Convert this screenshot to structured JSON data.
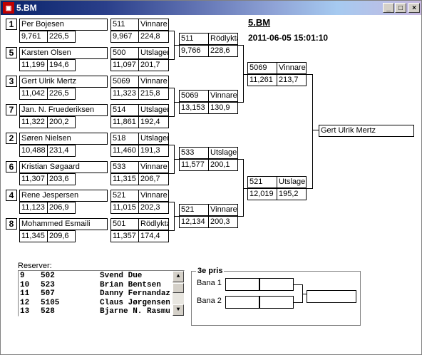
{
  "window": {
    "title": "5.BM",
    "icon": "app-icon",
    "minimize": "_",
    "maximize": "□",
    "close": "×"
  },
  "event": {
    "title": "5.BM",
    "datetime": "2011-06-05 15:01:10"
  },
  "round1": [
    {
      "seed": "1",
      "name": "Per Bojesen",
      "score1": "9,761",
      "score2": "226,5"
    },
    {
      "seed": "5",
      "name": "Karsten Olsen",
      "score1": "11,199",
      "score2": "194,6"
    },
    {
      "seed": "3",
      "name": "Gert Ulrik Mertz",
      "score1": "11,042",
      "score2": "226,5"
    },
    {
      "seed": "7",
      "name": "Jan. N. Fruederiksen",
      "score1": "11,322",
      "score2": "200,2"
    },
    {
      "seed": "2",
      "name": "Søren Nielsen",
      "score1": "10,488",
      "score2": "231,4"
    },
    {
      "seed": "6",
      "name": "Kristian Søgaard",
      "score1": "11,307",
      "score2": "203,6"
    },
    {
      "seed": "4",
      "name": "Rene Jespersen",
      "score1": "11,123",
      "score2": "206,9"
    },
    {
      "seed": "8",
      "name": "Mohammed Esmaili",
      "score1": "11,345",
      "score2": "209,6"
    }
  ],
  "round1_results": [
    {
      "num": "511",
      "status": "Vinnare",
      "score1": "9,967",
      "score2": "224,8"
    },
    {
      "num": "500",
      "status": "Utslagen",
      "score1": "11,097",
      "score2": "201,7"
    },
    {
      "num": "5069",
      "status": "Vinnare",
      "score1": "11,323",
      "score2": "215,8"
    },
    {
      "num": "514",
      "status": "Utslagen",
      "score1": "11,861",
      "score2": "192,4"
    },
    {
      "num": "518",
      "status": "Utslagen",
      "score1": "11,460",
      "score2": "191,3"
    },
    {
      "num": "533",
      "status": "Vinnare",
      "score1": "11,315",
      "score2": "206,7"
    },
    {
      "num": "521",
      "status": "Vinnare",
      "score1": "11,015",
      "score2": "202,3"
    },
    {
      "num": "501",
      "status": "Rödlykta",
      "score1": "11,357",
      "score2": "174,4"
    }
  ],
  "round2": [
    {
      "num": "511",
      "status": "Rödlykta",
      "score1": "9,766",
      "score2": "228,6"
    },
    {
      "num": "5069",
      "status": "Vinnare",
      "score1": "13,153",
      "score2": "130,9"
    },
    {
      "num": "533",
      "status": "Utslagen",
      "score1": "11,577",
      "score2": "200,1"
    },
    {
      "num": "521",
      "status": "Vinnare",
      "score1": "12,134",
      "score2": "200,3"
    }
  ],
  "round3": [
    {
      "num": "5069",
      "status": "Vinnare",
      "score1": "11,261",
      "score2": "213,7"
    },
    {
      "num": "521",
      "status": "Utslagen",
      "score1": "12,019",
      "score2": "195,2"
    }
  ],
  "winner": "Gert Ulrik Mertz",
  "reserves": {
    "label": "Reserver:",
    "rows": [
      {
        "pos": "9",
        "num": "502",
        "name": "Svend Due"
      },
      {
        "pos": "10",
        "num": "523",
        "name": "Brian Bentsen"
      },
      {
        "pos": "11",
        "num": "507",
        "name": "Danny Fernandaz"
      },
      {
        "pos": "12",
        "num": "5105",
        "name": "Claus Jørgensen"
      },
      {
        "pos": "13",
        "num": "528",
        "name": "Bjarne N. Rasmussen"
      }
    ]
  },
  "third_place": {
    "title": "3e pris",
    "lane1": "Bana 1",
    "lane2": "Bana 2"
  }
}
